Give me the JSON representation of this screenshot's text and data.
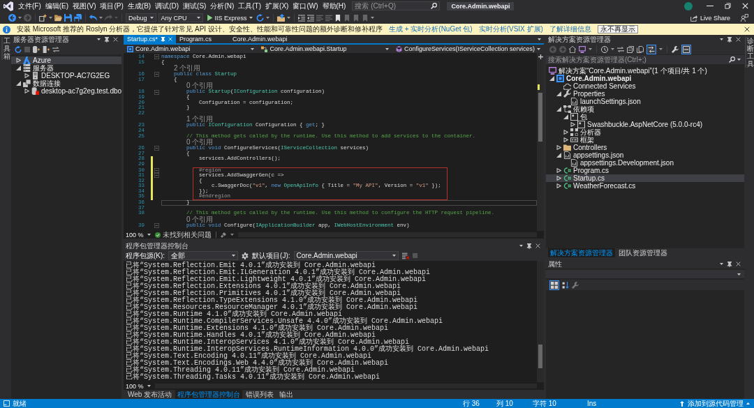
{
  "title_bar": {
    "menus": [
      "文件(F)",
      "编辑(E)",
      "视图(V)",
      "项目(P)",
      "生成(B)",
      "调试(D)",
      "测试(S)",
      "分析(N)",
      "工具(T)",
      "扩展(X)",
      "窗口(W)",
      "帮助(H)"
    ],
    "search": {
      "placeholder": "搜索 (Ctrl+Q)"
    },
    "solution_name": "Core.Admin.webapi"
  },
  "toolbar": {
    "configuration": "Debug",
    "platform": "Any CPU",
    "launch_target": "IIS Express",
    "live_share": "Live Share"
  },
  "info_bar": {
    "message": "安装 Microsoft 推荐的 Roslyn 分析器，它提供了针对常见 API 设计、安全性、性能和可靠性问题的额外诊断和修补程序",
    "links": [
      "生成 + 实时分析(NuGet 包)",
      "实时分析(VSIX 扩展)",
      "了解详细信息"
    ],
    "button": "永不再显示"
  },
  "left_dock": {
    "tabs": [
      "工具箱"
    ]
  },
  "server_explorer": {
    "title": "服务器资源管理器",
    "tree": [
      {
        "label": "Azure",
        "kind": "azure",
        "expanded": false,
        "selected": true
      },
      {
        "label": "服务器",
        "kind": "servers",
        "expanded": true,
        "selected": false,
        "children": [
          {
            "label": "DESKTOP-AC7G2EG",
            "kind": "server",
            "expanded": false,
            "selected": false
          }
        ]
      },
      {
        "label": "数据连接",
        "kind": "data_connections",
        "expanded": true,
        "selected": false,
        "children": [
          {
            "label": "desktop-ac7g2eg.test.dbo",
            "kind": "database",
            "expanded": false,
            "selected": false
          }
        ]
      }
    ]
  },
  "editor": {
    "tabs": [
      {
        "label": "Startup.cs*",
        "selected": true
      },
      {
        "label": "Program.cs",
        "selected": false
      },
      {
        "label": "Core.Admin.webapi",
        "selected": false
      }
    ],
    "navigation": {
      "project": "Core.Admin.webapi",
      "type": "Core.Admin.webapi.Startup",
      "member": "ConfigureServices(IServiceCollection services)"
    },
    "lines": [
      {
        "kind": "code",
        "number": "14",
        "foldable": true,
        "current": false,
        "tokens": [
          {
            "kind": "keyword",
            "text": "namespace"
          },
          {
            "kind": "plain",
            "text": " Core.Admin.webapi"
          }
        ]
      },
      {
        "kind": "code",
        "number": "15",
        "foldable": false,
        "current": false,
        "tokens": [
          {
            "kind": "plain",
            "text": "{"
          }
        ]
      },
      {
        "kind": "codelens",
        "text": "2 个引用"
      },
      {
        "kind": "code",
        "number": "16",
        "foldable": true,
        "current": false,
        "tokens": [
          {
            "kind": "keyword",
            "text": "    public class "
          },
          {
            "kind": "type",
            "text": "Startup"
          }
        ]
      },
      {
        "kind": "code",
        "number": "17",
        "foldable": false,
        "current": false,
        "tokens": [
          {
            "kind": "plain",
            "text": "    {"
          }
        ]
      },
      {
        "kind": "codelens",
        "text": "0 个引用"
      },
      {
        "kind": "code",
        "number": "18",
        "foldable": true,
        "current": false,
        "tokens": [
          {
            "kind": "keyword",
            "text": "        public "
          },
          {
            "kind": "type",
            "text": "Startup"
          },
          {
            "kind": "plain",
            "text": "("
          },
          {
            "kind": "type",
            "text": "IConfiguration"
          },
          {
            "kind": "plain",
            "text": " configuration)"
          }
        ]
      },
      {
        "kind": "code",
        "number": "19",
        "foldable": false,
        "current": false,
        "tokens": [
          {
            "kind": "plain",
            "text": "        {"
          }
        ]
      },
      {
        "kind": "code",
        "number": "20",
        "foldable": false,
        "current": false,
        "tokens": [
          {
            "kind": "plain",
            "text": "            Configuration = configuration;"
          }
        ]
      },
      {
        "kind": "code",
        "number": "21",
        "foldable": false,
        "current": false,
        "tokens": [
          {
            "kind": "plain",
            "text": "        }"
          }
        ]
      },
      {
        "kind": "code",
        "number": "22",
        "foldable": false,
        "current": false
      },
      {
        "kind": "codelens",
        "text": "1 个引用"
      },
      {
        "kind": "code",
        "number": "23",
        "foldable": false,
        "current": false,
        "tokens": [
          {
            "kind": "keyword",
            "text": "        public "
          },
          {
            "kind": "type",
            "text": "IConfiguration"
          },
          {
            "kind": "plain",
            "text": " Configuration { "
          },
          {
            "kind": "keyword",
            "text": "get"
          },
          {
            "kind": "plain",
            "text": "; }"
          }
        ]
      },
      {
        "kind": "code",
        "number": "24",
        "foldable": false,
        "current": false
      },
      {
        "kind": "code",
        "number": "25",
        "foldable": false,
        "current": false,
        "tokens": [
          {
            "kind": "comment",
            "text": "        // This method gets called by the runtime. Use this method to add services to the container."
          }
        ]
      },
      {
        "kind": "codelens",
        "text": "0 个引用"
      },
      {
        "kind": "code",
        "number": "26",
        "foldable": true,
        "current": false,
        "tokens": [
          {
            "kind": "keyword",
            "text": "        public void"
          },
          {
            "kind": "plain",
            "text": " ConfigureServices("
          },
          {
            "kind": "type",
            "text": "IServiceCollection"
          },
          {
            "kind": "plain",
            "text": " services)"
          }
        ]
      },
      {
        "kind": "code",
        "number": "27",
        "foldable": false,
        "current": false,
        "tokens": [
          {
            "kind": "plain",
            "text": "        {"
          }
        ]
      },
      {
        "kind": "changed_block",
        "lines": [
          {
            "kind": "code",
            "number": "28",
            "foldable": false,
            "current": false,
            "tokens": [
              {
                "kind": "plain",
                "text": "            services.AddControllers();"
              }
            ]
          },
          {
            "kind": "code",
            "number": "29",
            "foldable": false,
            "current": false
          },
          {
            "kind": "highlight_box",
            "lines": [
              {
                "kind": "code",
                "number": "30",
                "foldable": true,
                "current": false,
                "tokens": [
                  {
                    "kind": "preprocessor",
                    "text": "            #region"
                  }
                ]
              },
              {
                "kind": "code",
                "number": "31",
                "foldable": true,
                "current": false,
                "tokens": [
                  {
                    "kind": "plain",
                    "text": "            services.AddSwaggerGen(c =>"
                  }
                ]
              },
              {
                "kind": "code",
                "number": "32",
                "foldable": false,
                "current": false,
                "tokens": [
                  {
                    "kind": "plain",
                    "text": "            {"
                  }
                ]
              },
              {
                "kind": "code",
                "number": "33",
                "foldable": false,
                "current": false,
                "tokens": [
                  {
                    "kind": "plain",
                    "text": "                c.SwaggerDoc("
                  },
                  {
                    "kind": "string",
                    "text": "\"v1\""
                  },
                  {
                    "kind": "plain",
                    "text": ", "
                  },
                  {
                    "kind": "keyword",
                    "text": "new "
                  },
                  {
                    "kind": "type",
                    "text": "OpenApiInfo"
                  },
                  {
                    "kind": "plain",
                    "text": " { Title = "
                  },
                  {
                    "kind": "string",
                    "text": "\"My API\""
                  },
                  {
                    "kind": "plain",
                    "text": ", Version = "
                  },
                  {
                    "kind": "string",
                    "text": "\"v1\""
                  },
                  {
                    "kind": "plain",
                    "text": " });"
                  }
                ]
              },
              {
                "kind": "code",
                "number": "34",
                "foldable": false,
                "current": false,
                "tokens": [
                  {
                    "kind": "plain",
                    "text": "            });"
                  }
                ]
              },
              {
                "kind": "code",
                "number": "35",
                "foldable": false,
                "current": false,
                "tokens": [
                  {
                    "kind": "preprocessor",
                    "text": "            #endregion"
                  }
                ]
              }
            ]
          }
        ]
      },
      {
        "kind": "code",
        "number": "36",
        "foldable": false,
        "current": true,
        "tokens": [
          {
            "kind": "plain",
            "text": "        }"
          }
        ]
      },
      {
        "kind": "code",
        "number": "37",
        "foldable": false,
        "current": false
      },
      {
        "kind": "code",
        "number": "38",
        "foldable": false,
        "current": false,
        "tokens": [
          {
            "kind": "comment",
            "text": "        // This method gets called by the runtime. Use this method to configure the HTTP request pipeline."
          }
        ]
      },
      {
        "kind": "codelens",
        "text": "0 个引用"
      },
      {
        "kind": "code",
        "number": "39",
        "foldable": true,
        "current": false,
        "tokens": [
          {
            "kind": "keyword",
            "text": "        public void"
          },
          {
            "kind": "plain",
            "text": " Configure("
          },
          {
            "kind": "type",
            "text": "IApplicationBuilder"
          },
          {
            "kind": "plain",
            "text": " app, "
          },
          {
            "kind": "type",
            "text": "IWebHostEnvironment"
          },
          {
            "kind": "plain",
            "text": " env)"
          }
        ]
      }
    ],
    "zoom": "100 %",
    "issues": "未找到相关问题"
  },
  "package_manager_console": {
    "title": "程序包管理器控制台",
    "source_label": "程序包源(K):",
    "source": "全部",
    "project_label": "默认项目(J):",
    "project": "Core.Admin.webapi",
    "output": [
      "已将“System.Reflection.Emit 4.0.1”成功安装到 Core.Admin.webapi",
      "已将“System.Reflection.Emit.ILGeneration 4.0.1”成功安装到 Core.Admin.webapi",
      "已将“System.Reflection.Emit.Lightweight 4.0.1”成功安装到 Core.Admin.webapi",
      "已将“System.Reflection.Extensions 4.0.1”成功安装到 Core.Admin.webapi",
      "已将“System.Reflection.Primitives 4.0.1”成功安装到 Core.Admin.webapi",
      "已将“System.Reflection.TypeExtensions 4.1.0”成功安装到 Core.Admin.webapi",
      "已将“System.Resources.ResourceManager 4.0.1”成功安装到 Core.Admin.webapi",
      "已将“System.Runtime 4.1.0”成功安装到 Core.Admin.webapi",
      "已将“System.Runtime.CompilerServices.Unsafe 4.4.0”成功安装到 Core.Admin.webapi",
      "已将“System.Runtime.Extensions 4.1.0”成功安装到 Core.Admin.webapi",
      "已将“System.Runtime.Handles 4.0.1”成功安装到 Core.Admin.webapi",
      "已将“System.Runtime.InteropServices 4.1.0”成功安装到 Core.Admin.webapi",
      "已将“System.Runtime.InteropServices.RuntimeInformation 4.0.0”成功安装到 Core.Admin.webapi",
      "已将“System.Text.Encoding 4.0.11”成功安装到 Core.Admin.webapi",
      "已将“System.Text.Encodings.Web 4.4.0”成功安装到 Core.Admin.webapi",
      "已将“System.Threading 4.0.11”成功安装到 Core.Admin.webapi",
      "已将“System.Threading.Tasks 4.0.11”成功安装到 Core.Admin.webapi"
    ],
    "zoom": "100 %"
  },
  "bottom_tabs": [
    {
      "label": "Web 发布活动",
      "selected": false
    },
    {
      "label": "程序包管理器控制台",
      "selected": true
    },
    {
      "label": "错误列表",
      "selected": false
    },
    {
      "label": "输出",
      "selected": false
    }
  ],
  "solution_explorer": {
    "title": "解决方案资源管理器",
    "track_active_item": true,
    "preview_selected_items": true,
    "search": {
      "placeholder": "搜索解决方案资源管理器(Ctrl+;)"
    },
    "tree": [
      {
        "label": "解决方案“Core.Admin.webapi”(1 个项目/共 1 个)",
        "kind": "solution",
        "selected": false,
        "children": [
          {
            "label": "Core.Admin.webapi",
            "kind": "project",
            "expanded": true,
            "selected": false,
            "children": [
              {
                "label": "Connected Services",
                "kind": "connected_services",
                "selected": false
              },
              {
                "label": "Properties",
                "kind": "properties",
                "expanded": true,
                "selected": false,
                "children": [
                  {
                    "label": "launchSettings.json",
                    "kind": "json",
                    "selected": false
                  }
                ]
              },
              {
                "label": "依赖项",
                "kind": "dependencies",
                "expanded": true,
                "selected": false,
                "children": [
                  {
                    "label": "包",
                    "kind": "package",
                    "expanded": true,
                    "selected": false,
                    "children": [
                      {
                        "label": "Swashbuckle.AspNetCore (5.0.0-rc4)",
                        "kind": "package",
                        "expanded": false,
                        "selected": false
                      }
                    ]
                  },
                  {
                    "label": "分析器",
                    "kind": "analyzers",
                    "expanded": false,
                    "selected": false
                  },
                  {
                    "label": "框架",
                    "kind": "frameworks",
                    "expanded": false,
                    "selected": false
                  }
                ]
              },
              {
                "label": "Controllers",
                "kind": "folder",
                "expanded": false,
                "selected": false
              },
              {
                "label": "appsettings.json",
                "kind": "json",
                "expanded": true,
                "selected": false,
                "children": [
                  {
                    "label": "appsettings.Development.json",
                    "kind": "json",
                    "selected": false
                  }
                ]
              },
              {
                "label": "Program.cs",
                "kind": "csharp",
                "expanded": false,
                "selected": false
              },
              {
                "label": "Startup.cs",
                "kind": "csharp",
                "expanded": false,
                "selected": true
              },
              {
                "label": "WeatherForecast.cs",
                "kind": "csharp",
                "expanded": false,
                "selected": false
              }
            ]
          }
        ]
      }
    ],
    "tabs": [
      {
        "label": "解决方案资源管理器",
        "selected": true
      },
      {
        "label": "团队资源管理器",
        "selected": false
      }
    ]
  },
  "properties": {
    "title": "属性",
    "categorized": true
  },
  "right_dock": {
    "tabs": [
      "诊断工具"
    ]
  },
  "status_bar": {
    "message": "就绪",
    "line": "行 36",
    "column": "列 10",
    "character": "字符 10",
    "insert_mode": "Ins",
    "source_control": "添加到源代码管理"
  }
}
